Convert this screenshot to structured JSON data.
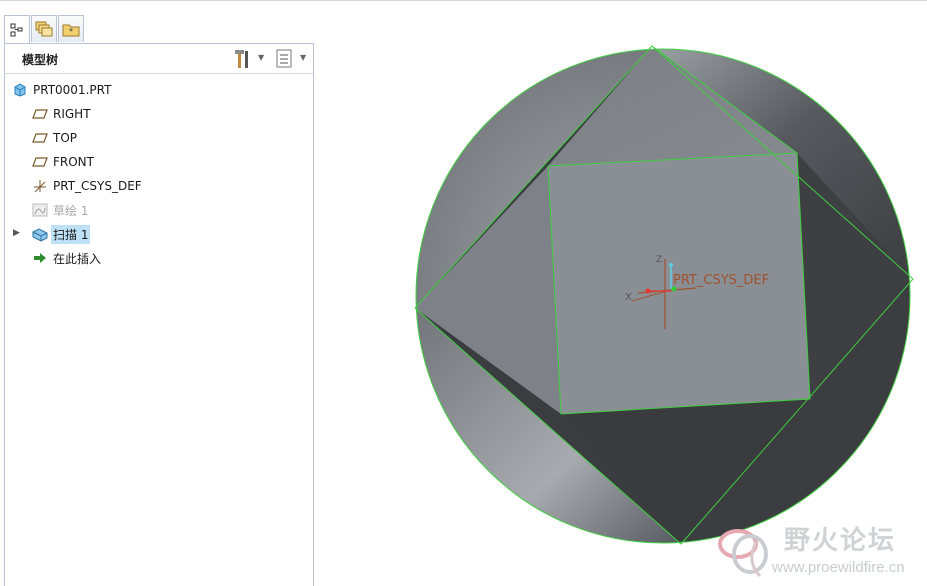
{
  "navigator": {
    "tabs": [
      {
        "icon": "model-tree-icon",
        "active": true
      },
      {
        "icon": "layers-icon",
        "active": false
      },
      {
        "icon": "favorites-folder-icon",
        "active": false
      }
    ],
    "panel_title": "模型树"
  },
  "tree": {
    "root": "PRT0001.PRT",
    "right_plane": "RIGHT",
    "top_plane": "TOP",
    "front_plane": "FRONT",
    "csys": "PRT_CSYS_DEF",
    "sketch": "草绘 1",
    "sweep": "扫描 1",
    "insert_here": "在此插入"
  },
  "viewport": {
    "csys_label": "PRT_CSYS_DEF",
    "axis_x": "X",
    "axis_z": "Z",
    "edge_color": "#3fcf3f",
    "csys_color": "#a0522d"
  },
  "watermark": {
    "title": "野火论坛",
    "url": "www.proewildfire.cn"
  }
}
